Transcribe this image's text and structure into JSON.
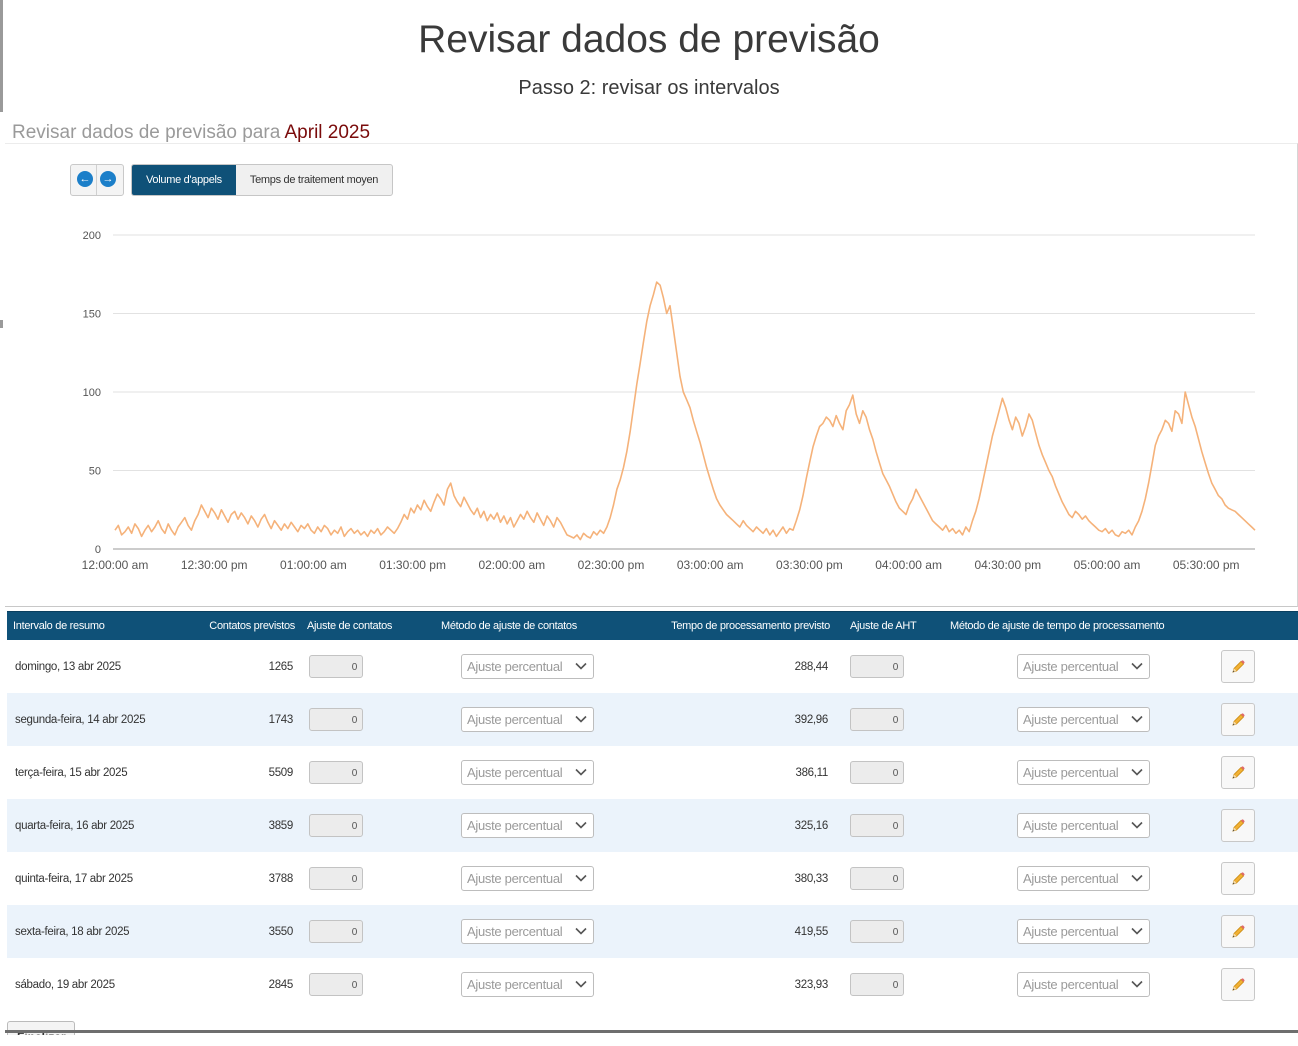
{
  "page": {
    "title": "Revisar dados de previsão",
    "step": "Passo 2: revisar os intervalos",
    "review_prefix": "Revisar dados de previsão para",
    "review_month": "April 2025"
  },
  "chart_toolbar": {
    "prev_icon": "arrow-left-icon",
    "next_icon": "arrow-right-icon",
    "tabs": [
      "Volume d'appels",
      "Temps de traitement moyen"
    ],
    "active_tab": 0
  },
  "chart_data": {
    "type": "line",
    "title": "",
    "xlabel": "",
    "ylabel": "",
    "ylim": [
      0,
      200
    ],
    "yticks": [
      0,
      50,
      100,
      150,
      200
    ],
    "xticks": [
      "12:00:00 am",
      "12:30:00 pm",
      "01:00:00 am",
      "01:30:00 pm",
      "02:00:00 am",
      "02:30:00 pm",
      "03:00:00 am",
      "03:30:00 pm",
      "04:00:00 am",
      "04:30:00 pm",
      "05:00:00 am",
      "05:30:00 pm"
    ],
    "grid": true,
    "color": "#f5b27a",
    "series": [
      {
        "values": [
          12,
          15,
          9,
          11,
          14,
          10,
          16,
          13,
          8,
          12,
          15,
          11,
          14,
          18,
          13,
          10,
          16,
          12,
          9,
          14,
          17,
          20,
          15,
          12,
          18,
          22,
          28,
          24,
          20,
          26,
          23,
          19,
          25,
          21,
          17,
          22,
          24,
          19,
          23,
          20,
          16,
          21,
          18,
          14,
          19,
          22,
          17,
          13,
          18,
          15,
          12,
          16,
          13,
          17,
          14,
          11,
          15,
          13,
          16,
          12,
          10,
          14,
          11,
          15,
          13,
          9,
          12,
          10,
          14,
          8,
          11,
          13,
          10,
          12,
          9,
          11,
          8,
          12,
          10,
          13,
          9,
          11,
          14,
          12,
          10,
          13,
          17,
          22,
          19,
          26,
          23,
          28,
          25,
          31,
          27,
          24,
          30,
          35,
          32,
          28,
          38,
          42,
          34,
          30,
          27,
          33,
          29,
          25,
          22,
          26,
          20,
          24,
          18,
          22,
          19,
          23,
          17,
          21,
          16,
          20,
          14,
          18,
          22,
          19,
          24,
          20,
          17,
          23,
          19,
          15,
          21,
          18,
          14,
          20,
          17,
          13,
          9,
          8,
          7,
          9,
          6,
          10,
          8,
          7,
          11,
          9,
          12,
          10,
          14,
          20,
          28,
          38,
          44,
          52,
          62,
          75,
          90,
          105,
          118,
          132,
          145,
          155,
          162,
          170,
          168,
          160,
          150,
          155,
          140,
          125,
          110,
          100,
          95,
          90,
          82,
          75,
          68,
          60,
          52,
          45,
          38,
          32,
          28,
          25,
          22,
          20,
          18,
          16,
          14,
          18,
          15,
          13,
          11,
          14,
          12,
          10,
          13,
          9,
          12,
          8,
          11,
          14,
          10,
          13,
          12,
          18,
          25,
          34,
          45,
          55,
          65,
          72,
          78,
          80,
          84,
          82,
          78,
          85,
          80,
          76,
          88,
          92,
          98,
          86,
          80,
          88,
          84,
          76,
          70,
          62,
          55,
          48,
          44,
          40,
          35,
          30,
          26,
          24,
          22,
          28,
          32,
          38,
          34,
          30,
          26,
          22,
          18,
          16,
          14,
          12,
          15,
          11,
          13,
          10,
          12,
          9,
          14,
          11,
          18,
          24,
          32,
          42,
          52,
          62,
          72,
          80,
          88,
          96,
          90,
          82,
          76,
          84,
          80,
          72,
          78,
          86,
          82,
          74,
          66,
          60,
          55,
          50,
          46,
          40,
          35,
          30,
          26,
          22,
          20,
          24,
          22,
          19,
          21,
          18,
          16,
          14,
          12,
          11,
          13,
          10,
          12,
          9,
          8,
          11,
          10,
          12,
          9,
          14,
          18,
          24,
          32,
          42,
          54,
          66,
          72,
          76,
          82,
          80,
          75,
          88,
          86,
          80,
          100,
          92,
          84,
          78,
          70,
          62,
          55,
          48,
          42,
          38,
          34,
          32,
          28,
          26,
          25,
          24,
          22,
          20,
          18,
          16,
          14,
          12
        ],
        "x_start": "12:00:00 am",
        "x_end": "05:30:00 pm"
      }
    ]
  },
  "table": {
    "headers": [
      "Intervalo de resumo",
      "Contatos previstos",
      "Ajuste de contatos",
      "Método de ajuste de contatos",
      "Tempo de processamento previsto",
      "Ajuste de AHT",
      "Método de ajuste de tempo de processamento",
      ""
    ],
    "method_option": "Ajuste percentual",
    "edit_icon": "pencil-icon",
    "rows": [
      {
        "interval": "domingo, 13 abr 2025",
        "contacts": "1265",
        "contact_adj": "0",
        "aht": "288,44",
        "aht_adj": "0"
      },
      {
        "interval": "segunda-feira, 14 abr 2025",
        "contacts": "1743",
        "contact_adj": "0",
        "aht": "392,96",
        "aht_adj": "0"
      },
      {
        "interval": "terça-feira, 15 abr 2025",
        "contacts": "5509",
        "contact_adj": "0",
        "aht": "386,11",
        "aht_adj": "0"
      },
      {
        "interval": "quarta-feira, 16 abr 2025",
        "contacts": "3859",
        "contact_adj": "0",
        "aht": "325,16",
        "aht_adj": "0"
      },
      {
        "interval": "quinta-feira, 17 abr 2025",
        "contacts": "3788",
        "contact_adj": "0",
        "aht": "380,33",
        "aht_adj": "0"
      },
      {
        "interval": "sexta-feira, 18 abr 2025",
        "contacts": "3550",
        "contact_adj": "0",
        "aht": "419,55",
        "aht_adj": "0"
      },
      {
        "interval": "sábado, 19 abr 2025",
        "contacts": "2845",
        "contact_adj": "0",
        "aht": "323,93",
        "aht_adj": "0"
      }
    ]
  },
  "footer": {
    "finish_label": "Finalizar"
  }
}
